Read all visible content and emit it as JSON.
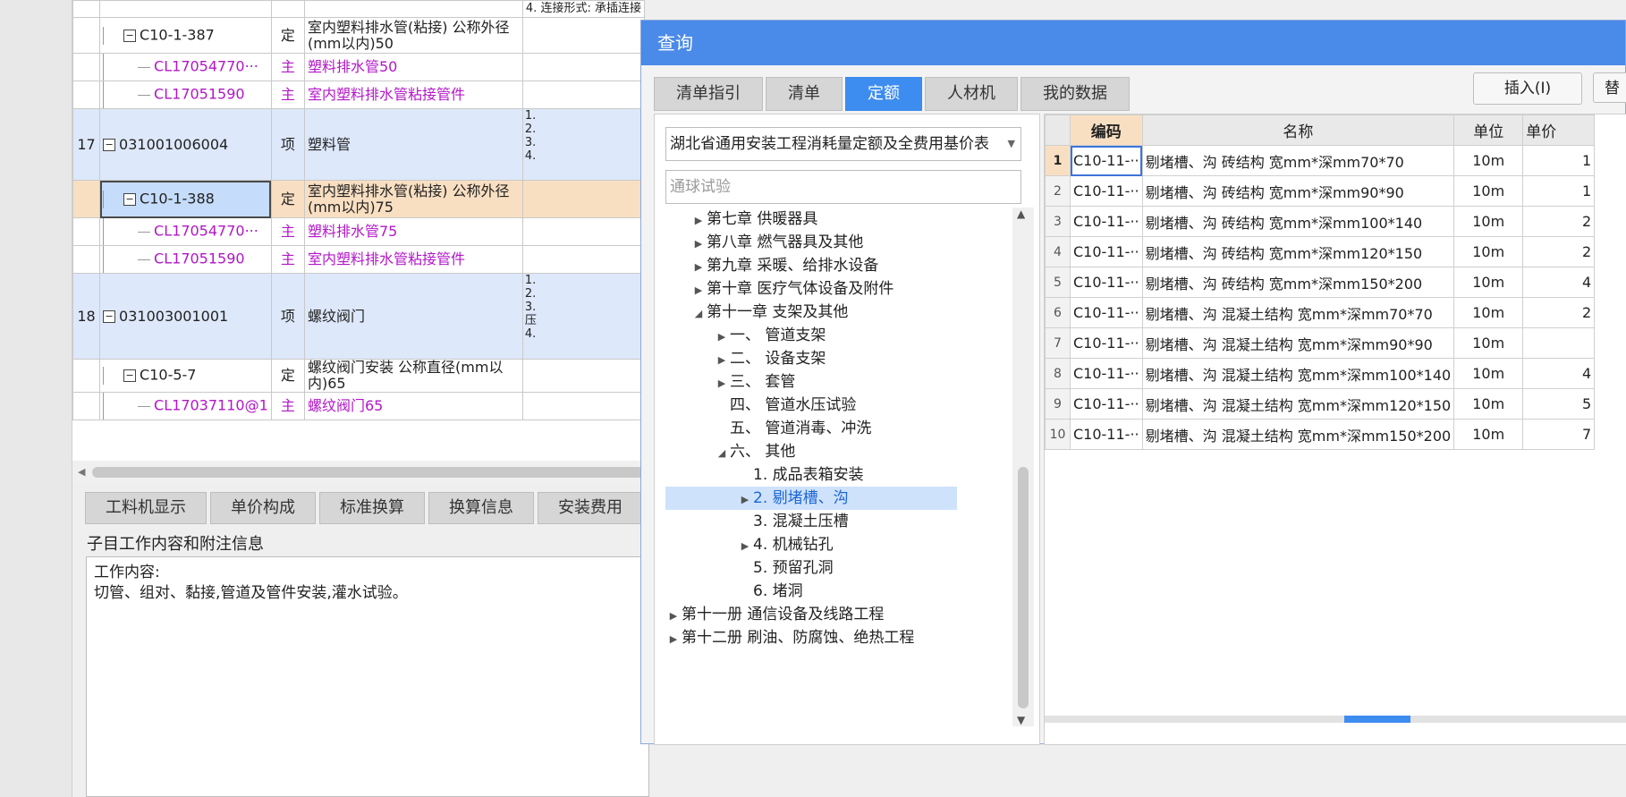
{
  "grid": {
    "rows": [
      {
        "num": "",
        "code": "C10-1-387",
        "type": "定",
        "name": "室内塑料排水管(粘接) 公称外径 (mm以内)50",
        "kind": "quota"
      },
      {
        "num": "",
        "code": "CL17054770···",
        "type": "主",
        "name": "塑料排水管50",
        "kind": "material"
      },
      {
        "num": "",
        "code": "CL17051590",
        "type": "主",
        "name": "室内塑料排水管粘接管件",
        "kind": "material"
      },
      {
        "num": "17",
        "code": "031001006004",
        "type": "项",
        "name": "塑料管",
        "kind": "item",
        "features": [
          "1.",
          "2.",
          "3.",
          "4."
        ]
      },
      {
        "num": "",
        "code": "C10-1-388",
        "type": "定",
        "name": "室内塑料排水管(粘接) 公称外径 (mm以内)75",
        "kind": "quota-selected"
      },
      {
        "num": "",
        "code": "CL17054770···",
        "type": "主",
        "name": "塑料排水管75",
        "kind": "material"
      },
      {
        "num": "",
        "code": "CL17051590",
        "type": "主",
        "name": "室内塑料排水管粘接管件",
        "kind": "material"
      },
      {
        "num": "18",
        "code": "031003001001",
        "type": "项",
        "name": "螺纹阀门",
        "kind": "item",
        "features": [
          "1.",
          "2.",
          "3.",
          "压",
          "4."
        ]
      },
      {
        "num": "",
        "code": "C10-5-7",
        "type": "定",
        "name": "螺纹阀门安装 公称直径(mm以内)65",
        "kind": "quota"
      },
      {
        "num": "",
        "code": "CL17037110@1",
        "type": "主",
        "name": "螺纹阀门65",
        "kind": "material"
      }
    ],
    "top_partial": "4. 连接形式: 承插连接"
  },
  "bottom_tabs": [
    "工料机显示",
    "单价构成",
    "标准换算",
    "换算信息",
    "安装费用"
  ],
  "info": {
    "label": "子目工作内容和附注信息",
    "line1": "工作内容:",
    "line2": "切管、组对、黏接,管道及管件安装,灌水试验。"
  },
  "dialog": {
    "title": "查询",
    "tabs": [
      "清单指引",
      "清单",
      "定额",
      "人材机",
      "我的数据"
    ],
    "active_tab": "定额",
    "insert_label": "插入(I)",
    "replace_label": "替",
    "quota_library": "湖北省通用安装工程消耗量定额及全费用基价表",
    "search_placeholder": "通球试验",
    "tree": [
      {
        "label": "第七章 供暖器具",
        "caret": "right",
        "level": 1
      },
      {
        "label": "第八章 燃气器具及其他",
        "caret": "right",
        "level": 1
      },
      {
        "label": "第九章 采暖、给排水设备",
        "caret": "right",
        "level": 1
      },
      {
        "label": "第十章 医疗气体设备及附件",
        "caret": "right",
        "level": 1
      },
      {
        "label": "第十一章 支架及其他",
        "caret": "down",
        "level": 1
      },
      {
        "label": "一、 管道支架",
        "caret": "right",
        "level": 2
      },
      {
        "label": "二、 设备支架",
        "caret": "right",
        "level": 2
      },
      {
        "label": "三、 套管",
        "caret": "right",
        "level": 2
      },
      {
        "label": "四、 管道水压试验",
        "caret": "",
        "level": 2
      },
      {
        "label": "五、 管道消毒、冲洗",
        "caret": "",
        "level": 2
      },
      {
        "label": "六、 其他",
        "caret": "down",
        "level": 2
      },
      {
        "label": "1. 成品表箱安装",
        "caret": "",
        "level": 3
      },
      {
        "label": "2. 剔堵槽、沟",
        "caret": "right",
        "level": 3,
        "selected": true
      },
      {
        "label": "3. 混凝土压槽",
        "caret": "",
        "level": 3
      },
      {
        "label": "4. 机械钻孔",
        "caret": "right",
        "level": 3
      },
      {
        "label": "5. 预留孔洞",
        "caret": "",
        "level": 3
      },
      {
        "label": "6. 堵洞",
        "caret": "",
        "level": 3
      },
      {
        "label": "第十一册 通信设备及线路工程",
        "caret": "right",
        "level": 0
      },
      {
        "label": "第十二册 刷油、防腐蚀、绝热工程",
        "caret": "right",
        "level": 0
      }
    ],
    "result_headers": {
      "code": "编码",
      "name": "名称",
      "unit": "单位",
      "price": "单价"
    },
    "results": [
      {
        "no": "1",
        "code": "C10-11-··",
        "name": "剔堵槽、沟 砖结构 宽mm*深mm70*70",
        "unit": "10m",
        "price": "1"
      },
      {
        "no": "2",
        "code": "C10-11-··",
        "name": "剔堵槽、沟 砖结构 宽mm*深mm90*90",
        "unit": "10m",
        "price": "1"
      },
      {
        "no": "3",
        "code": "C10-11-··",
        "name": "剔堵槽、沟 砖结构 宽mm*深mm100*140",
        "unit": "10m",
        "price": "2"
      },
      {
        "no": "4",
        "code": "C10-11-··",
        "name": "剔堵槽、沟 砖结构 宽mm*深mm120*150",
        "unit": "10m",
        "price": "2"
      },
      {
        "no": "5",
        "code": "C10-11-··",
        "name": "剔堵槽、沟 砖结构 宽mm*深mm150*200",
        "unit": "10m",
        "price": "4"
      },
      {
        "no": "6",
        "code": "C10-11-··",
        "name": "剔堵槽、沟 混凝土结构 宽mm*深mm70*70",
        "unit": "10m",
        "price": "2"
      },
      {
        "no": "7",
        "code": "C10-11-··",
        "name": "剔堵槽、沟 混凝土结构 宽mm*深mm90*90",
        "unit": "10m",
        "price": ""
      },
      {
        "no": "8",
        "code": "C10-11-··",
        "name": "剔堵槽、沟 混凝土结构 宽mm*深mm100*140",
        "unit": "10m",
        "price": "4"
      },
      {
        "no": "9",
        "code": "C10-11-··",
        "name": "剔堵槽、沟 混凝土结构 宽mm*深mm120*150",
        "unit": "10m",
        "price": "5"
      },
      {
        "no": "10",
        "code": "C10-11-··",
        "name": "剔堵槽、沟 混凝土结构 宽mm*深mm150*200",
        "unit": "10m",
        "price": "7"
      }
    ]
  }
}
